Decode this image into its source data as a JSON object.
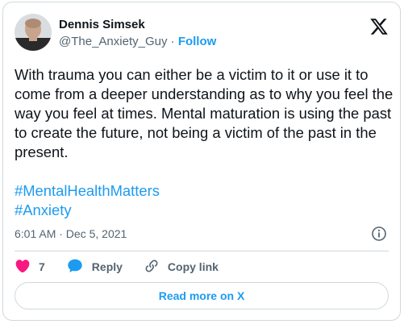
{
  "author": {
    "display_name": "Dennis Simsek",
    "handle": "@The_Anxiety_Guy",
    "separator": "·",
    "follow_label": "Follow"
  },
  "tweet": {
    "text": "With trauma you can either be a victim to it or use it to come from a deeper understanding as to why you feel the way you feel at times. Mental maturation is using the past to create the future, not being a victim of the past in the present.",
    "hashtags": [
      "#MentalHealthMatters",
      "#Anxiety"
    ],
    "timestamp": "6:01 AM · Dec 5, 2021"
  },
  "actions": {
    "like_count": "7",
    "reply_label": "Reply",
    "copy_link_label": "Copy link"
  },
  "footer": {
    "read_more_label": "Read more on X"
  },
  "icons": {
    "brand_logo": "x-logo-icon",
    "info": "info-icon",
    "like": "heart-icon",
    "reply": "speech-bubble-icon",
    "copy_link": "link-icon"
  },
  "colors": {
    "accent": "#1d9bf0",
    "like": "#f91880",
    "text": "#0f1419",
    "muted": "#536471",
    "border": "#cfd9de"
  }
}
